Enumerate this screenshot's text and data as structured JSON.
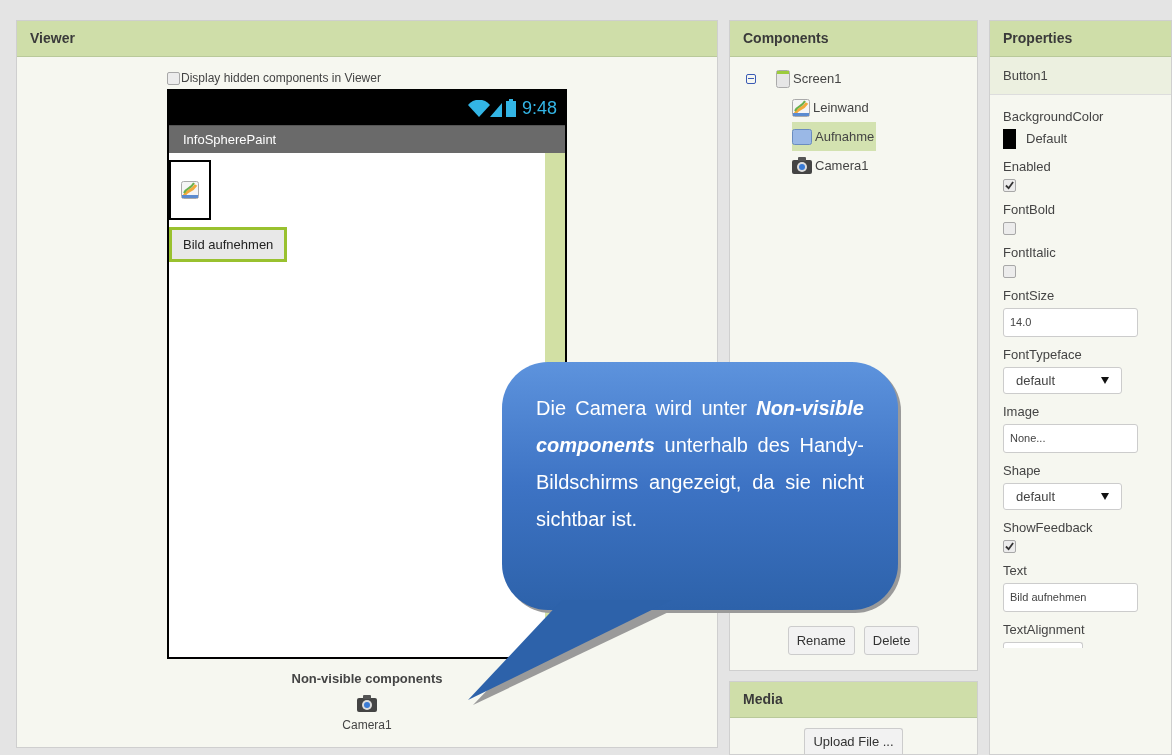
{
  "viewer": {
    "title": "Viewer",
    "hidden_toggle": {
      "label": "Display hidden components in Viewer",
      "checked": false
    },
    "phone": {
      "time": "9:48",
      "app_title": "InfoSpherePaint",
      "button_label": "Bild aufnehmen"
    },
    "nonvisible": {
      "title": "Non-visible components",
      "items": [
        {
          "label": "Camera1"
        }
      ]
    }
  },
  "components": {
    "title": "Components",
    "tree": [
      {
        "label": "Screen1",
        "kind": "screen",
        "expanded": true,
        "selected": false,
        "children": [
          {
            "label": "Leinwand",
            "kind": "canvas",
            "selected": false
          },
          {
            "label": "Aufnahme",
            "kind": "button",
            "selected": true
          },
          {
            "label": "Camera1",
            "kind": "camera",
            "selected": false
          }
        ]
      }
    ],
    "buttons": [
      "Rename",
      "Delete"
    ]
  },
  "media": {
    "title": "Media",
    "button": "Upload File ..."
  },
  "properties": {
    "title": "Properties",
    "component": "Button1",
    "items": [
      {
        "label": "BackgroundColor",
        "kind": "color",
        "value": "Default",
        "color": "#000000"
      },
      {
        "label": "Enabled",
        "kind": "checkbox",
        "checked": true
      },
      {
        "label": "FontBold",
        "kind": "checkbox",
        "checked": false
      },
      {
        "label": "FontItalic",
        "kind": "checkbox",
        "checked": false
      },
      {
        "label": "FontSize",
        "kind": "text",
        "value": "14.0"
      },
      {
        "label": "FontTypeface",
        "kind": "select",
        "value": "default"
      },
      {
        "label": "Image",
        "kind": "text",
        "value": "None..."
      },
      {
        "label": "Shape",
        "kind": "select",
        "value": "default"
      },
      {
        "label": "ShowFeedback",
        "kind": "checkbox",
        "checked": true
      },
      {
        "label": "Text",
        "kind": "text",
        "value": "Bild aufnehmen"
      },
      {
        "label": "TextAlignment",
        "kind": "partial"
      }
    ]
  },
  "callout": {
    "text": "Die Camera wird unter **Non-visible components** unterhalb des Handy-Bildschirms angezeigt, da sie nicht sichtbar ist."
  }
}
